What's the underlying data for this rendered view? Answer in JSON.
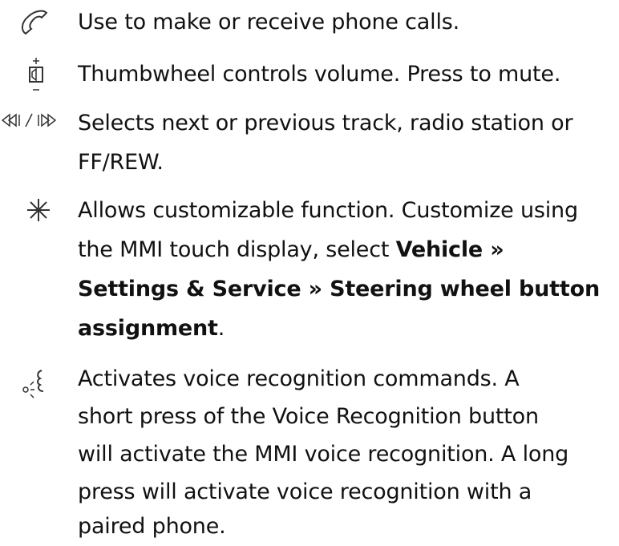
{
  "items": [
    {
      "icon": "phone-icon",
      "text": "Use to make or receive phone calls."
    },
    {
      "icon": "volume-thumbwheel-icon",
      "text": "Thumbwheel controls volume. Press to mute."
    },
    {
      "icon": "next-previous-track-icon",
      "line1": "Selects next or previous track, radio station or",
      "line2": "FF/REW."
    },
    {
      "icon": "asterisk-icon",
      "line1": "Allows customizable function. Customize using",
      "line2_plain": "the MMI touch display, select ",
      "line2_bold": "Vehicle »",
      "line3_bold_a": "Settings & Service",
      "line3_sep": " » ",
      "line3_bold_b": "Steering wheel button",
      "line4_bold": "assignment",
      "line4_plain": "."
    },
    {
      "icon": "voice-recognition-icon",
      "line1": "Activates voice recognition commands. A",
      "line2": "short press of the Voice Recognition button",
      "line3": "will activate the MMI voice recognition. A long",
      "line4": "press will activate voice recognition with a",
      "line5": "paired phone."
    }
  ]
}
